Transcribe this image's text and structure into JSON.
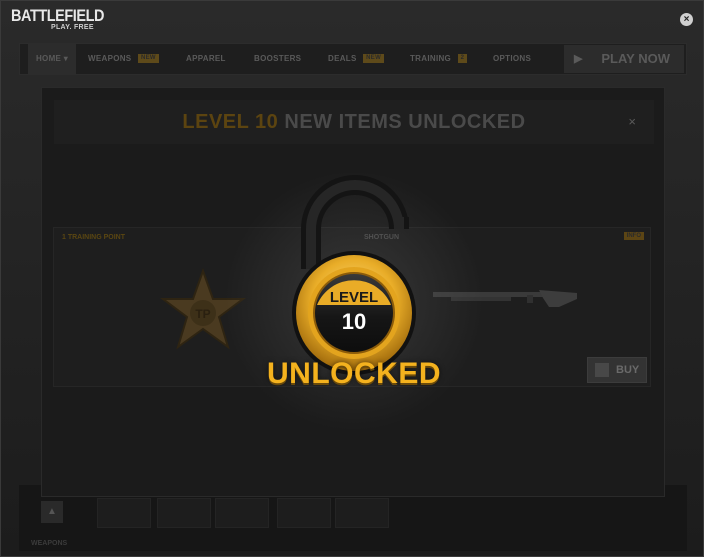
{
  "app": {
    "logo": "BATTLEFIELD",
    "logo_sub": "PLAY. FREE",
    "close_glyph": "×"
  },
  "nav": {
    "items": [
      {
        "label": "HOME",
        "badge": ""
      },
      {
        "label": "WEAPONS",
        "badge": "NEW"
      },
      {
        "label": "APPAREL",
        "badge": ""
      },
      {
        "label": "BOOSTERS",
        "badge": ""
      },
      {
        "label": "DEALS",
        "badge": "NEW"
      },
      {
        "label": "TRAINING",
        "badge": "2"
      },
      {
        "label": "OPTIONS",
        "badge": ""
      }
    ],
    "play_now": "PLAY NOW"
  },
  "modal": {
    "title_level": "LEVEL 10",
    "title_rest": "NEW ITEMS UNLOCKED",
    "close_glyph": "×",
    "card_left_label": "1 TRAINING POINT",
    "card_right_label": "SHOTGUN",
    "info_label": "INFO",
    "tp_label": "TP",
    "buy_label": "BUY"
  },
  "unlock": {
    "level_word": "LEVEL",
    "level_number": "10",
    "status": "UNLOCKED"
  },
  "bottom": {
    "label": "WEAPONS"
  },
  "colors": {
    "accent": "#f4b21e",
    "badge_ring": "#e3a41e",
    "badge_bg": "#1c1c1c"
  }
}
